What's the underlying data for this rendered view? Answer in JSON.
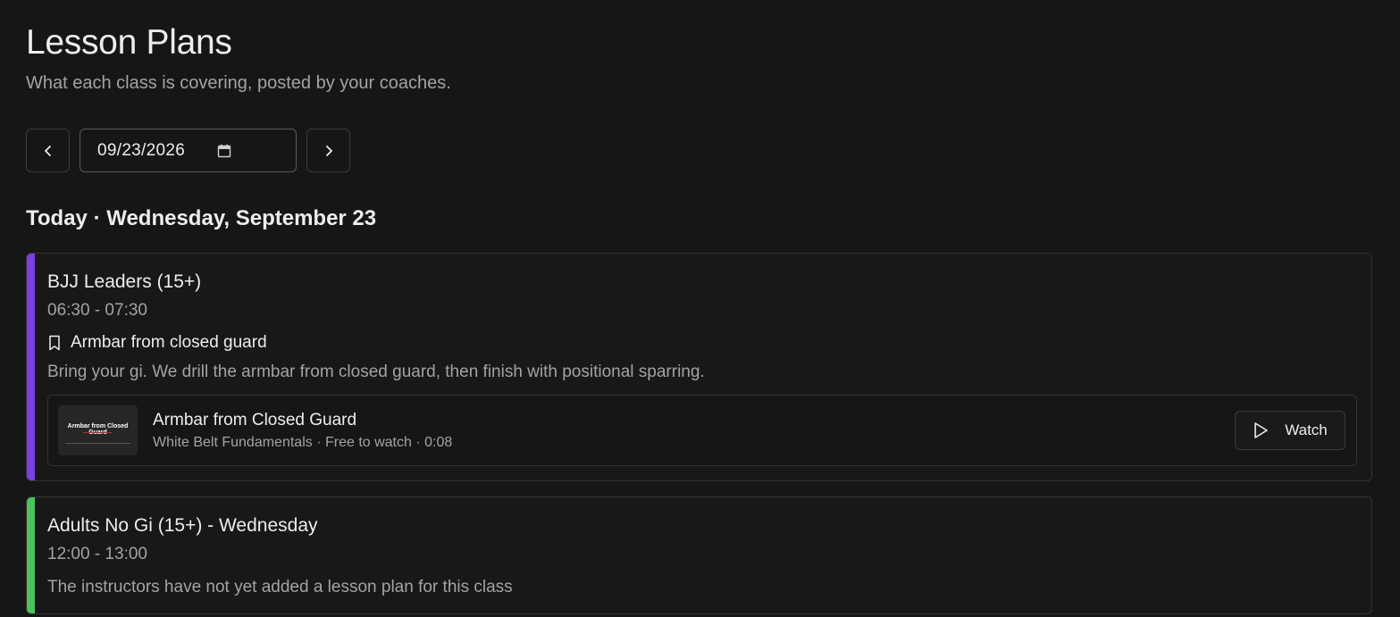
{
  "header": {
    "title": "Lesson Plans",
    "subtitle": "What each class is covering, posted by your coaches."
  },
  "date_nav": {
    "prev_icon": "chevron-left-icon",
    "date_value": "09/23/2026",
    "calendar_icon": "calendar-icon",
    "next_icon": "chevron-right-icon"
  },
  "day_heading": "Today · Wednesday, September 23",
  "classes": [
    {
      "name": "BJJ Leaders (15+)",
      "time": "06:30 - 07:30",
      "accent_color": "#7b3fe4",
      "topic_icon": "bookmark-icon",
      "topic": "Armbar from closed guard",
      "description": "Bring your gi. We drill the armbar from closed guard, then finish with positional sparring.",
      "video": {
        "thumbnail_text": "Armbar from Closed Guard",
        "title": "Armbar from Closed Guard",
        "meta": "White Belt Fundamentals · Free to watch · 0:08",
        "watch_icon": "play-icon",
        "watch_label": "Watch"
      }
    },
    {
      "name": "Adults No Gi (15+) - Wednesday",
      "time": "12:00 - 13:00",
      "accent_color": "#4cc15c",
      "description": "The instructors have not yet added a lesson plan for this class"
    }
  ],
  "colors": {
    "background": "#161616",
    "text": "#ededed",
    "muted_text": "#a3a3a3",
    "border": "#333333"
  }
}
